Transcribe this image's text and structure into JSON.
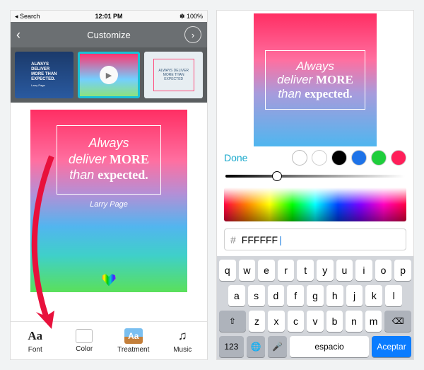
{
  "status": {
    "back": "Search",
    "time": "12:01 PM",
    "right": "✽ 100%"
  },
  "nav": {
    "title": "Customize"
  },
  "templates": {
    "t1_lines": [
      "ALWAYS",
      "DELIVER",
      "MORE THAN",
      "EXPECTED."
    ],
    "t1_author": "Larry Page",
    "t3_text": "ALWAYS DELIVER MORE THAN EXPECTED"
  },
  "poster": {
    "line1_a": "Always",
    "line2_a": "deliver",
    "line2_b": "MORE",
    "line3_a": "than",
    "line3_b": "expected.",
    "author": "Larry Page"
  },
  "tabs": {
    "font": "Font",
    "color": "Color",
    "treatment": "Treatment",
    "music": "Music",
    "fontGlyph": "Aa",
    "treatGlyph": "Aa",
    "musicGlyph": "♫"
  },
  "picker": {
    "done": "Done",
    "swatches": [
      "#ffffff",
      "#000000",
      "#1e73e8",
      "#1fce3c",
      "#ff1f5a"
    ],
    "hash": "#",
    "hex": "FFFFFF"
  },
  "keyboard": {
    "r1": [
      "q",
      "w",
      "e",
      "r",
      "t",
      "y",
      "u",
      "i",
      "o",
      "p"
    ],
    "r2": [
      "a",
      "s",
      "d",
      "f",
      "g",
      "h",
      "j",
      "k",
      "l"
    ],
    "shift": "⇧",
    "r3": [
      "z",
      "x",
      "c",
      "v",
      "b",
      "n",
      "m"
    ],
    "bksp": "⌫",
    "num": "123",
    "globe": "🌐",
    "mic": "🎤",
    "space": "espacio",
    "accept": "Aceptar"
  }
}
